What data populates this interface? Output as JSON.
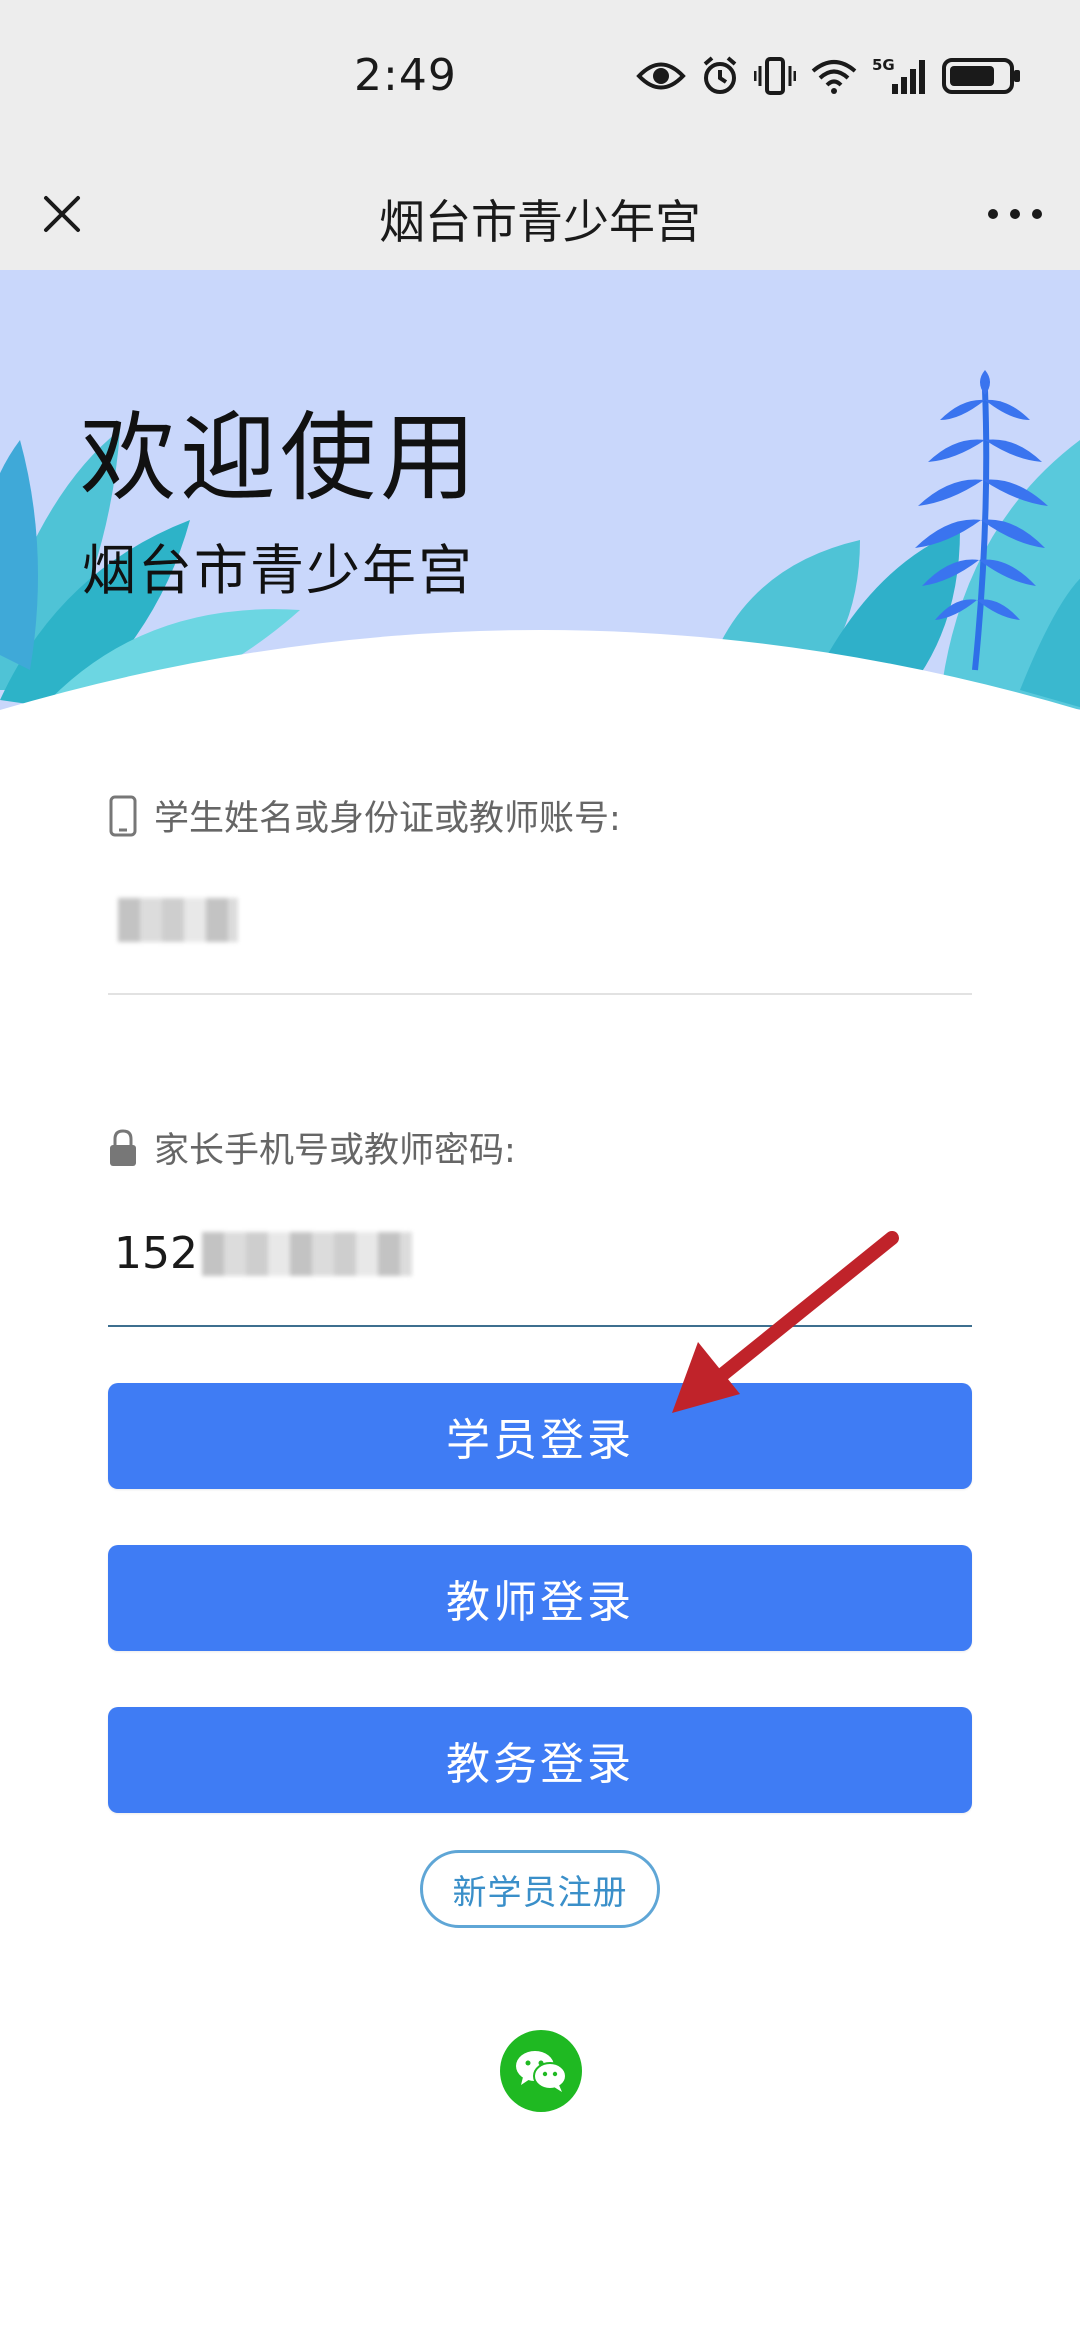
{
  "status_bar": {
    "time": "2:49",
    "icons": [
      "eye-icon",
      "alarm-icon",
      "vibrate-icon",
      "wifi-icon",
      "signal-5g-icon",
      "battery-icon"
    ],
    "network_label": "5G"
  },
  "title_bar": {
    "title": "烟台市青少年宫",
    "close_icon": "close-icon",
    "more_icon": "more-icon"
  },
  "hero": {
    "title": "欢迎使用",
    "subtitle": "烟台市青少年宫",
    "background_color": "#c9d7fb"
  },
  "form": {
    "account": {
      "label": "学生姓名或身份证或教师账号:",
      "icon": "phone-icon",
      "value_visible": ""
    },
    "password": {
      "label": "家长手机号或教师密码:",
      "icon": "lock-icon",
      "value_visible": "152"
    }
  },
  "buttons": {
    "student_login": "学员登录",
    "teacher_login": "教师登录",
    "admin_login": "教务登录",
    "register": "新学员注册"
  },
  "colors": {
    "primary_button": "#3f7cf4",
    "register_border": "#5fa6d6",
    "wechat_green": "#1fb922",
    "annotation_arrow": "#c0232a"
  },
  "footer": {
    "icon": "wechat-icon"
  }
}
